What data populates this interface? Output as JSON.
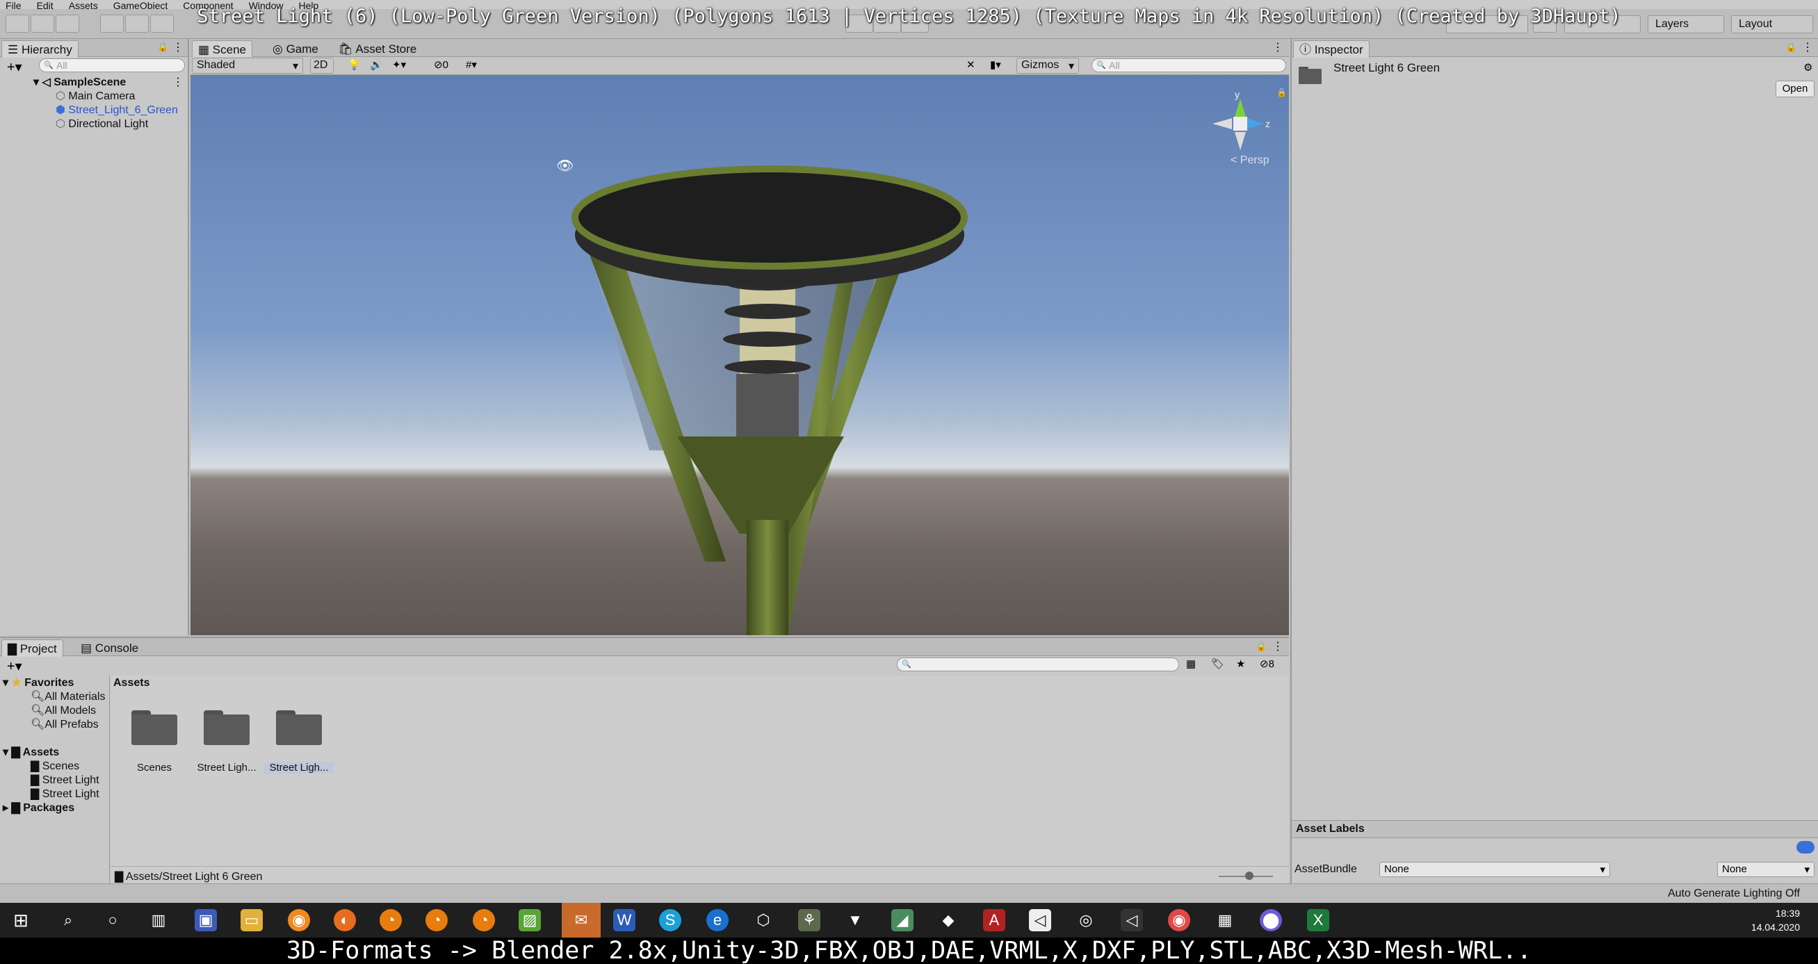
{
  "menu": [
    "File",
    "Edit",
    "Assets",
    "GameObject",
    "Component",
    "Window",
    "Help"
  ],
  "video_title": "Street Light (6) (Low-Poly Green Version) (Polygons 1613 | Vertices 1285) (Texture Maps in 4k Resolution) (Created by 3DHaupt)",
  "toolbar": {
    "layers": "Layers",
    "layout": "Layout"
  },
  "hierarchy": {
    "tab": "Hierarchy",
    "search_placeholder": "All",
    "scene": "SampleScene",
    "items": [
      "Main Camera",
      "Street_Light_6_Green",
      "Directional Light"
    ]
  },
  "scene_view": {
    "tabs": [
      "Scene",
      "Game",
      "Asset Store"
    ],
    "shading": "Shaded",
    "mode_2d": "2D",
    "hidden_count": "0",
    "gizmos": "Gizmos",
    "search_placeholder": "All",
    "persp": "< Persp",
    "axis_y": "y",
    "axis_z": "z"
  },
  "inspector": {
    "tab": "Inspector",
    "asset_name": "Street Light 6 Green",
    "open_button": "Open",
    "asset_labels": "Asset Labels",
    "asset_bundle_label": "AssetBundle",
    "asset_bundle_value": "None",
    "asset_variant_value": "None"
  },
  "project": {
    "tabs": [
      "Project",
      "Console"
    ],
    "favorites": "Favorites",
    "favorite_items": [
      "All Materials",
      "All Models",
      "All Prefabs"
    ],
    "assets_root": "Assets",
    "asset_folders": [
      "Scenes",
      "Street Light",
      "Street Light"
    ],
    "packages": "Packages",
    "header": "Assets",
    "folders": [
      "Scenes",
      "Street Ligh...",
      "Street Ligh..."
    ],
    "path": "Assets/Street Light 6 Green",
    "badge_count": "8"
  },
  "status": {
    "lighting": "Auto Generate Lighting Off"
  },
  "taskbar": {
    "time": "18:39",
    "date": "14.04.2020"
  },
  "caption": "3D-Formats -> Blender 2.8x,Unity-3D,FBX,OBJ,DAE,VRML,X,DXF,PLY,STL,ABC,X3D-Mesh-WRL.."
}
